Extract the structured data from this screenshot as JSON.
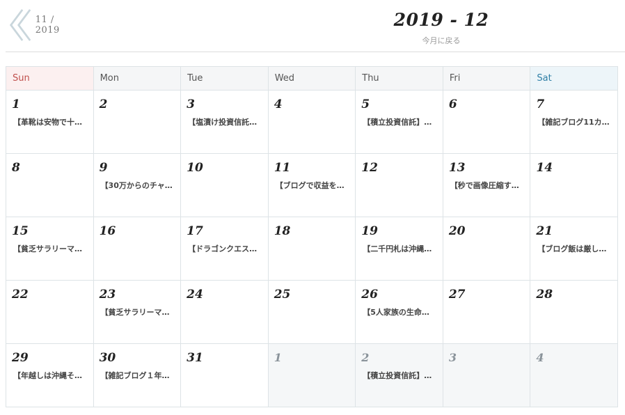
{
  "nav": {
    "prev_label": "11 / 2019"
  },
  "header": {
    "title": "2019 - 12",
    "back_label": "今月に戻る"
  },
  "weekdays": [
    "Sun",
    "Mon",
    "Tue",
    "Wed",
    "Thu",
    "Fri",
    "Sat"
  ],
  "weeks": [
    [
      {
        "day": "1",
        "event": "【革靴は安物で十…"
      },
      {
        "day": "2",
        "event": ""
      },
      {
        "day": "3",
        "event": "【塩漬け投資信託…"
      },
      {
        "day": "4",
        "event": ""
      },
      {
        "day": "5",
        "event": "【積立投資信託】…"
      },
      {
        "day": "6",
        "event": ""
      },
      {
        "day": "7",
        "event": "【雑記ブログ11カ…"
      }
    ],
    [
      {
        "day": "8",
        "event": ""
      },
      {
        "day": "9",
        "event": "【30万からのチャ…"
      },
      {
        "day": "10",
        "event": ""
      },
      {
        "day": "11",
        "event": "【ブログで収益を…"
      },
      {
        "day": "12",
        "event": ""
      },
      {
        "day": "13",
        "event": "【秒で画像圧縮す…"
      },
      {
        "day": "14",
        "event": ""
      }
    ],
    [
      {
        "day": "15",
        "event": "【貧乏サラリーマ…"
      },
      {
        "day": "16",
        "event": ""
      },
      {
        "day": "17",
        "event": "【ドラゴンクエス…"
      },
      {
        "day": "18",
        "event": ""
      },
      {
        "day": "19",
        "event": "【二千円札は沖縄…"
      },
      {
        "day": "20",
        "event": ""
      },
      {
        "day": "21",
        "event": "【ブログ飯は厳し…"
      }
    ],
    [
      {
        "day": "22",
        "event": ""
      },
      {
        "day": "23",
        "event": "【貧乏サラリーマ…"
      },
      {
        "day": "24",
        "event": ""
      },
      {
        "day": "25",
        "event": ""
      },
      {
        "day": "26",
        "event": "【5人家族の生命…"
      },
      {
        "day": "27",
        "event": ""
      },
      {
        "day": "28",
        "event": ""
      }
    ],
    [
      {
        "day": "29",
        "event": "【年越しは沖縄そ…"
      },
      {
        "day": "30",
        "event": "【雑記ブログ１年…"
      },
      {
        "day": "31",
        "event": ""
      },
      {
        "day": "1",
        "event": "",
        "other": true
      },
      {
        "day": "2",
        "event": "【積立投資信託】…",
        "other": true
      },
      {
        "day": "3",
        "event": "",
        "other": true
      },
      {
        "day": "4",
        "event": "",
        "other": true
      }
    ]
  ]
}
